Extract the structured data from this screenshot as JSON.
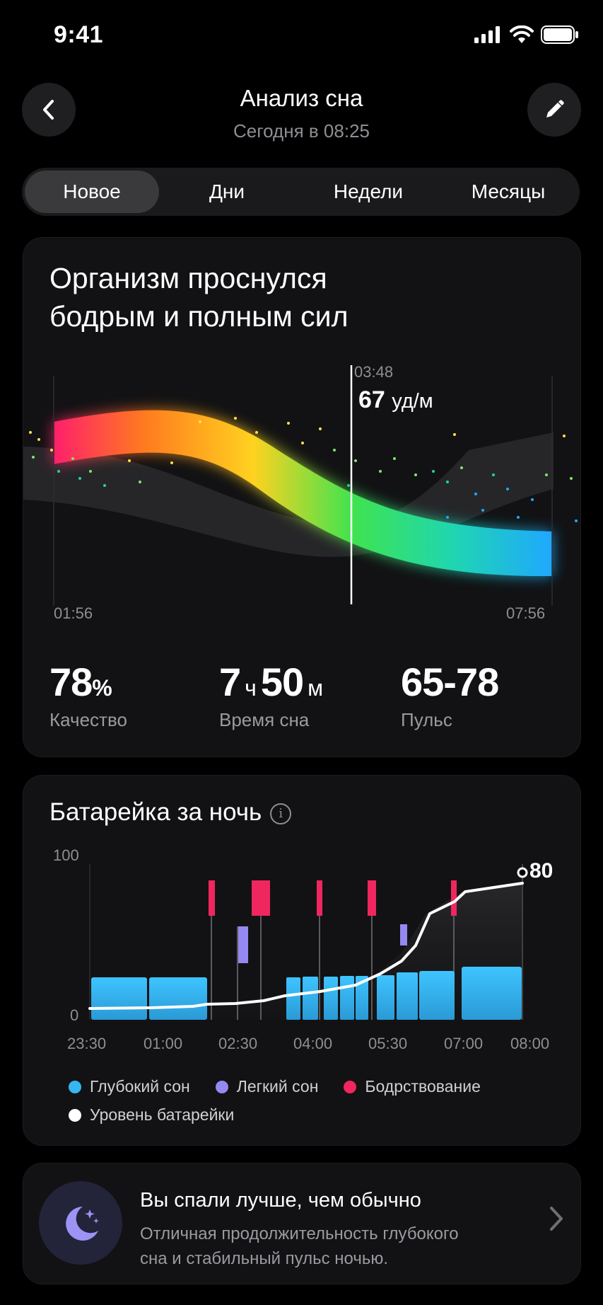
{
  "status": {
    "time": "9:41"
  },
  "header": {
    "title": "Анализ сна",
    "subtitle": "Сегодня в 08:25"
  },
  "tabs": [
    {
      "label": "Новое",
      "active": true
    },
    {
      "label": "Дни",
      "active": false
    },
    {
      "label": "Недели",
      "active": false
    },
    {
      "label": "Месяцы",
      "active": false
    }
  ],
  "summary": {
    "headline_line1": "Организм проснулся",
    "headline_line2": "бодрым и полным сил",
    "cursor_time": "03:48",
    "cursor_value": "67",
    "cursor_unit": "уд/м",
    "start_time": "01:56",
    "end_time": "07:56",
    "stats": [
      {
        "value": "78",
        "unit": "%",
        "label": "Качество"
      },
      {
        "value_h": "7",
        "unit_h": "ч",
        "value_m": "50",
        "unit_m": "м",
        "label": "Время сна"
      },
      {
        "value": "65-78",
        "label": "Пульс"
      }
    ]
  },
  "battery": {
    "title": "Батарейка за ночь",
    "y_max_label": "100",
    "y_min_label": "0",
    "end_value": "80",
    "x_labels": [
      "23:30",
      "01:00",
      "02:30",
      "04:00",
      "05:30",
      "07:00",
      "08:00"
    ],
    "legend": [
      {
        "label": "Глубокий сон",
        "color": "#36b6f0"
      },
      {
        "label": "Легкий сон",
        "color": "#9489f0"
      },
      {
        "label": "Бодрствование",
        "color": "#f0265f"
      },
      {
        "label": "Уровень батарейки",
        "color": "#ffffff"
      }
    ]
  },
  "tip": {
    "title": "Вы спали лучше, чем обычно",
    "line1": "Отличная продолжительность глубокого",
    "line2": "сна и стабильный пульс ночью."
  },
  "colors": {
    "accent_deep": "#36b6f0",
    "accent_light": "#9489f0",
    "accent_awake": "#f0265f",
    "card_bg": "#121214"
  },
  "icons": [
    "back-chevron-icon",
    "pencil-icon",
    "signal-icon",
    "wifi-icon",
    "battery-icon",
    "info-icon",
    "moon-stars-icon",
    "chevron-right-icon"
  ]
}
